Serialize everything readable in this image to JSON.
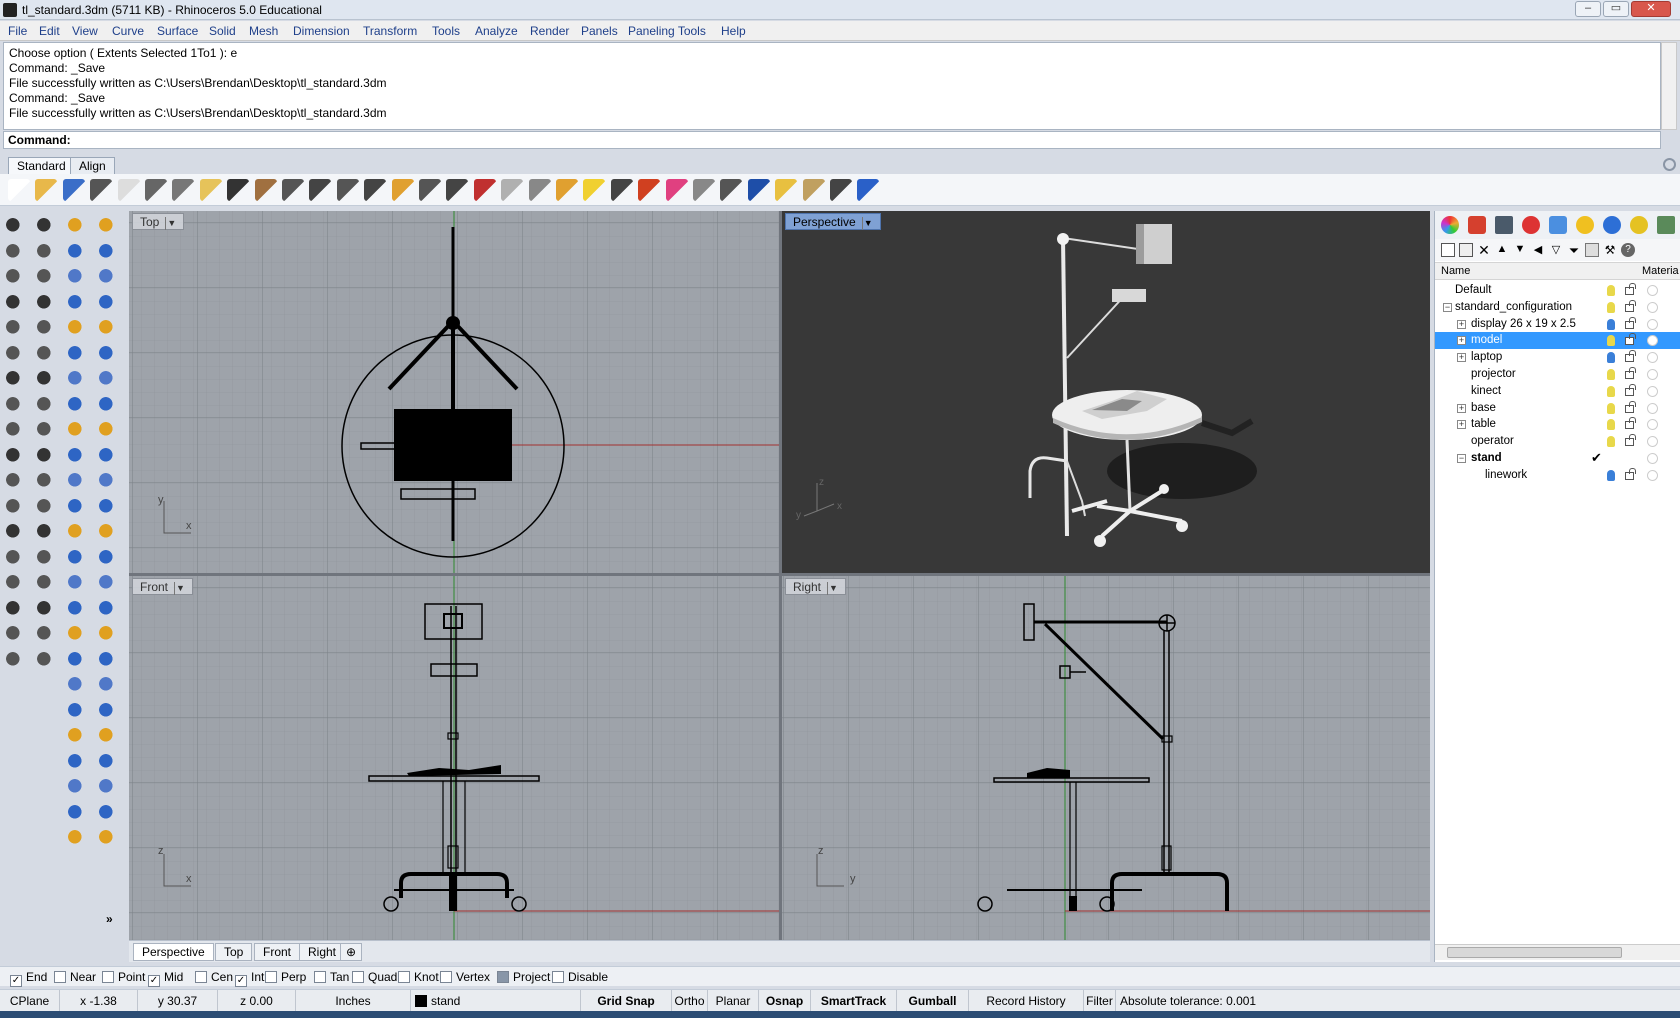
{
  "window": {
    "title": "tl_standard.3dm (5711 KB) - Rhinoceros 5.0 Educational"
  },
  "menu": [
    "File",
    "Edit",
    "View",
    "Curve",
    "Surface",
    "Solid",
    "Mesh",
    "Dimension",
    "Transform",
    "Tools",
    "Analyze",
    "Render",
    "Panels",
    "Paneling Tools",
    "Help"
  ],
  "command_history": [
    "Choose option ( Extents  Selected  1To1 ): e",
    "Command: _Save",
    "File successfully written as C:\\Users\\Brendan\\Desktop\\tl_standard.3dm",
    "Command: _Save",
    "File successfully written as C:\\Users\\Brendan\\Desktop\\tl_standard.3dm"
  ],
  "command_prompt": {
    "label": "Command:",
    "value": ""
  },
  "toolbar_tabs": [
    "Standard",
    "Align"
  ],
  "toolbar_icons": [
    "new-icon",
    "open-icon",
    "save-icon",
    "print-icon",
    "import-icon",
    "cut-icon",
    "copy-icon",
    "paste-icon",
    "undo-icon",
    "pan-icon",
    "rotate-view-icon",
    "zoom-dynamic-icon",
    "zoom-window-icon",
    "zoom-extents-icon",
    "zoom-selected-icon",
    "rotate-camera-icon",
    "four-viewports-icon",
    "car-shaded-icon",
    "car-wireframe-icon",
    "grid-icon",
    "snap-icon",
    "light-icon",
    "lock-icon",
    "layer-icon",
    "color-wheel-icon",
    "shaded-sphere-icon",
    "rendered-sphere-icon",
    "render-icon",
    "properties-icon",
    "options-icon",
    "dimension-icon",
    "help-icon"
  ],
  "viewports": {
    "top": {
      "label": "Top"
    },
    "perspective": {
      "label": "Perspective"
    },
    "front": {
      "label": "Front"
    },
    "right": {
      "label": "Right"
    }
  },
  "axis_labels": {
    "top": [
      "y",
      "x"
    ],
    "perspective": [
      "z",
      "y",
      "x"
    ],
    "front": [
      "z",
      "x"
    ],
    "right": [
      "z",
      "y"
    ]
  },
  "viewport_tabs": [
    "Perspective",
    "Top",
    "Front",
    "Right"
  ],
  "layers": {
    "columns": {
      "name": "Name",
      "material": "Materia"
    },
    "rows": [
      {
        "name": "Default",
        "indent": 0,
        "expander": "",
        "bulb": "#e8d84a",
        "selected": false,
        "current": false
      },
      {
        "name": "standard_configuration",
        "indent": 0,
        "expander": "−",
        "bulb": "#e8d84a",
        "selected": false,
        "current": false
      },
      {
        "name": "display 26 x 19 x 2.5",
        "indent": 1,
        "expander": "+",
        "bulb": "#3a7fd8",
        "selected": false,
        "current": false
      },
      {
        "name": "model",
        "indent": 1,
        "expander": "+",
        "bulb": "#e8d84a",
        "selected": true,
        "current": false
      },
      {
        "name": "laptop",
        "indent": 1,
        "expander": "+",
        "bulb": "#3a7fd8",
        "selected": false,
        "current": false
      },
      {
        "name": "projector",
        "indent": 1,
        "expander": "",
        "bulb": "#e8d84a",
        "selected": false,
        "current": false
      },
      {
        "name": "kinect",
        "indent": 1,
        "expander": "",
        "bulb": "#e8d84a",
        "selected": false,
        "current": false
      },
      {
        "name": "base",
        "indent": 1,
        "expander": "+",
        "bulb": "#e8d84a",
        "selected": false,
        "current": false
      },
      {
        "name": "table",
        "indent": 1,
        "expander": "+",
        "bulb": "#e8d84a",
        "selected": false,
        "current": false
      },
      {
        "name": "operator",
        "indent": 1,
        "expander": "",
        "bulb": "#e8d84a",
        "selected": false,
        "current": false
      },
      {
        "name": "stand",
        "indent": 1,
        "expander": "−",
        "bulb": "",
        "selected": false,
        "current": true
      },
      {
        "name": "linework",
        "indent": 2,
        "expander": "",
        "bulb": "#3a7fd8",
        "selected": false,
        "current": false
      }
    ]
  },
  "osnaps": [
    {
      "label": "End",
      "checked": true
    },
    {
      "label": "Near",
      "checked": false
    },
    {
      "label": "Point",
      "checked": false
    },
    {
      "label": "Mid",
      "checked": true
    },
    {
      "label": "Cen",
      "checked": false
    },
    {
      "label": "Int",
      "checked": true
    },
    {
      "label": "Perp",
      "checked": false
    },
    {
      "label": "Tan",
      "checked": false
    },
    {
      "label": "Quad",
      "checked": false
    },
    {
      "label": "Knot",
      "checked": false
    },
    {
      "label": "Vertex",
      "checked": false
    },
    {
      "label": "Project",
      "checked": false
    },
    {
      "label": "Disable",
      "checked": false
    }
  ],
  "status": {
    "cplane": "CPlane",
    "x": "x -1.38",
    "y": "y 30.37",
    "z": "z 0.00",
    "units": "Inches",
    "layer": "stand",
    "layer_color": "#000000",
    "buttons": [
      {
        "label": "Grid Snap",
        "bold": true
      },
      {
        "label": "Ortho",
        "bold": false
      },
      {
        "label": "Planar",
        "bold": false
      },
      {
        "label": "Osnap",
        "bold": true
      },
      {
        "label": "SmartTrack",
        "bold": true
      },
      {
        "label": "Gumball",
        "bold": true
      },
      {
        "label": "Record History",
        "bold": false
      },
      {
        "label": "Filter",
        "bold": false
      }
    ],
    "tolerance": "Absolute tolerance: 0.001"
  },
  "colors": {
    "perspective_bg": "#383838",
    "ortho_bg": "#9ea3aa",
    "selection": "#3399ff"
  }
}
